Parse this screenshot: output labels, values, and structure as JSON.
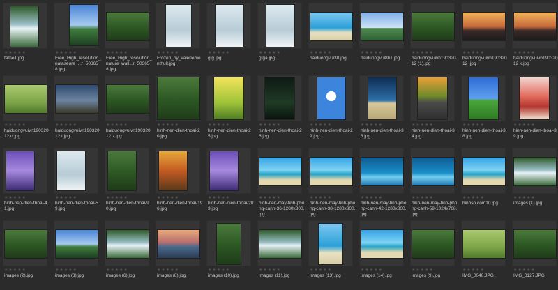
{
  "rating_glyph": "★★★★★",
  "rows": [
    [
      {
        "name": "fame1.jpg",
        "art": "waterfall"
      },
      {
        "name": "Free_High_resolution_nataseure_...r_503658.jpg",
        "art": "sky-b"
      },
      {
        "name": "Free_High_resolution_nature_wall...r_503658.jpg",
        "art": "forest"
      },
      {
        "name": "Frozen_by_valeriemonthult.jpg",
        "art": "snow"
      },
      {
        "name": "gfg.jpg",
        "art": "snow"
      },
      {
        "name": "gfga.jpg",
        "art": "snow"
      },
      {
        "name": "haiduongvui38.jpg",
        "art": "sea"
      },
      {
        "name": "haiduongvui861.jpg",
        "art": "sky-a"
      },
      {
        "name": "haiduongvuivn19032012 (1).jpg",
        "art": "forest"
      },
      {
        "name": "haiduongvuivn19032012 .jpg",
        "art": "dusk"
      },
      {
        "name": "haiduongvuivn19032012 k.jpg",
        "art": "dusk"
      }
    ],
    [
      {
        "name": "haiduongvuivn19032012 o.jpg",
        "art": "meadow"
      },
      {
        "name": "haiduongvuivn19032012 t.jpg",
        "art": "castle"
      },
      {
        "name": "haiduongvuivn19032012 z.jpg",
        "art": "forest"
      },
      {
        "name": "hinh-nen-dien-thoai-20.jpg",
        "art": "forest"
      },
      {
        "name": "hinh-nen-dien-thoai-25.jpg",
        "art": "yellow"
      },
      {
        "name": "hinh-nen-dien-thoai-26.jpg",
        "art": "night"
      },
      {
        "name": "hinh-nen-dien-thoai-29.jpg",
        "art": "blue-heart"
      },
      {
        "name": "hinh-nen-dien-thoai-33.jpg",
        "art": "moon"
      },
      {
        "name": "hinh-nen-dien-thoai-34.jpg",
        "art": "road"
      },
      {
        "name": "hinh-nen-dien-thoai-38.jpg",
        "art": "grass"
      },
      {
        "name": "hinh-nen-dien-thoai-39.jpg",
        "art": "red-tree"
      }
    ],
    [
      {
        "name": "hinh-nen-dien-thoai-41.jpg",
        "art": "purple"
      },
      {
        "name": "hinh-nen-dien-thoai-59.jpg",
        "art": "snow"
      },
      {
        "name": "hinh-nen-dien-thoai-90.jpg",
        "art": "forest"
      },
      {
        "name": "hinh-nen-dien-thoai-196.jpg",
        "art": "autumn"
      },
      {
        "name": "hinh-nen-dien-thoai-203.jpg",
        "art": "purple"
      },
      {
        "name": "hinh-nen-may-tinh-phong-canh-36-1280x800.jpg",
        "art": "tropic"
      },
      {
        "name": "hinh-nen-may-tinh-phong-canh-38-1280x800.jpg",
        "art": "tropic"
      },
      {
        "name": "hinh-nen-may-tinh-phong-canh-42-1280x800.jpg",
        "art": "deep-sea"
      },
      {
        "name": "hinh-nen-may-tinh-phong-canh-59-1024x768.jpg",
        "art": "deep-sea"
      },
      {
        "name": "hinhso.com10.jpg",
        "art": "tropic"
      },
      {
        "name": "images (1).jpg",
        "art": "waterfall"
      }
    ],
    [
      {
        "name": "images (2).jpg",
        "art": "forest"
      },
      {
        "name": "images (3).jpg",
        "art": "sky-b"
      },
      {
        "name": "images (6).jpg",
        "art": "waterfall"
      },
      {
        "name": "images (8).jpg",
        "art": "sunset-sea"
      },
      {
        "name": "images (10).jpg",
        "art": "forest"
      },
      {
        "name": "images (11).jpg",
        "art": "waterfall"
      },
      {
        "name": "images (13).jpg",
        "art": "sea"
      },
      {
        "name": "images (14).jpg",
        "art": "tropic"
      },
      {
        "name": "images (9).jpg",
        "art": "forest"
      },
      {
        "name": "IMG_0040.JPG",
        "art": "meadow"
      },
      {
        "name": "IMG_0127.JPG",
        "art": "forest"
      }
    ]
  ]
}
